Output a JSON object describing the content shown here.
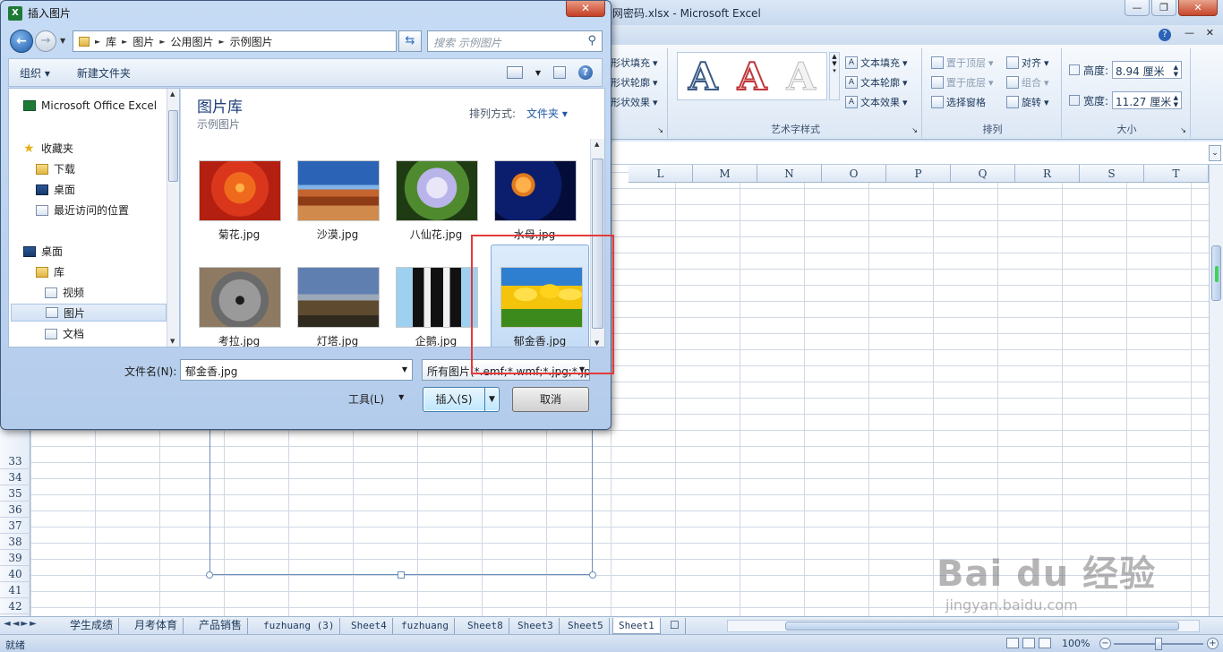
{
  "excel": {
    "window_title": "情网密码.xlsx - Microsoft Excel",
    "ribbon": {
      "shape_fill": "形状填充",
      "shape_outline": "形状轮廓",
      "shape_effect": "形状效果",
      "wordart_letter": "A",
      "text_fill": "文本填充",
      "text_outline": "文本轮廓",
      "text_effect": "文本效果",
      "wordart_group": "艺术字样式",
      "bring_front": "置于顶层",
      "send_back": "置于底层",
      "selection_pane": "选择窗格",
      "align": "对齐",
      "group": "组合",
      "rotate": "旋转",
      "arrange_group": "排列",
      "height_label": "高度:",
      "height_value": "8.94 厘米",
      "width_label": "宽度:",
      "width_value": "11.27 厘米",
      "size_group": "大小"
    },
    "columns": [
      "L",
      "M",
      "N",
      "O",
      "P",
      "Q",
      "R",
      "S",
      "T"
    ],
    "rows": [
      "33",
      "34",
      "35",
      "36",
      "37",
      "38",
      "39",
      "40",
      "41",
      "42"
    ],
    "sheets": [
      "学生成绩",
      "月考体育",
      "产品销售",
      "fuzhuang (3)",
      "Sheet4",
      "fuzhuang",
      "Sheet8",
      "Sheet3",
      "Sheet5",
      "Sheet1"
    ],
    "active_sheet": "Sheet1",
    "status": "就绪",
    "zoom": "100%"
  },
  "dialog": {
    "title": "插入图片",
    "breadcrumb": [
      "库",
      "图片",
      "公用图片",
      "示例图片"
    ],
    "search_placeholder": "搜索 示例图片",
    "organize": "组织 ▾",
    "new_folder": "新建文件夹",
    "nav": {
      "excel": "Microsoft Office Excel",
      "favorites": "收藏夹",
      "downloads": "下载",
      "desktop_fav": "桌面",
      "recent": "最近访问的位置",
      "desktop": "桌面",
      "library": "库",
      "videos": "视频",
      "pictures": "图片",
      "documents": "文档"
    },
    "library_title": "图片库",
    "library_sub": "示例图片",
    "arrange_label": "排列方式:",
    "arrange_value": "文件夹 ▾",
    "files": [
      "菊花.jpg",
      "沙漠.jpg",
      "八仙花.jpg",
      "水母.jpg",
      "考拉.jpg",
      "灯塔.jpg",
      "企鹅.jpg",
      "郁金香.jpg"
    ],
    "selected_file": "郁金香.jpg",
    "filename_label": "文件名(N):",
    "filename_value": "郁金香.jpg",
    "filetype_value": "所有图片(*.emf;*.wmf;*.jpg;*.jp",
    "tools": "工具(L)",
    "insert": "插入(S)",
    "cancel": "取消"
  },
  "watermark": {
    "brand": "Bai du 经验",
    "url": "jingyan.baidu.com"
  },
  "colors": {
    "highlight_box": "#e33a3a",
    "selection": "#c5dcf6"
  }
}
